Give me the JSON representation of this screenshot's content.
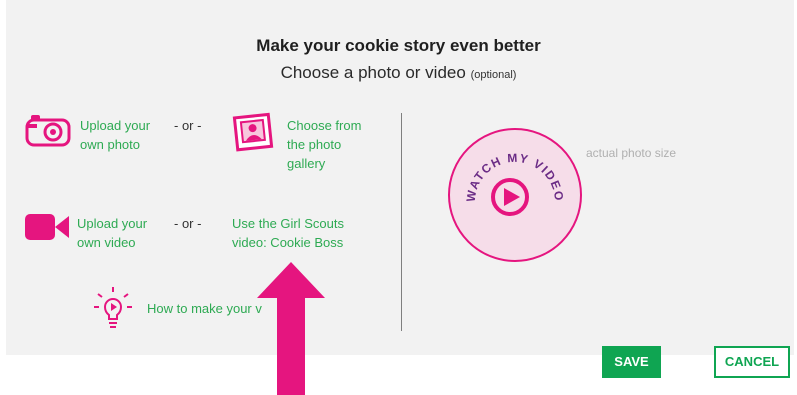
{
  "dialog": {
    "title": "Make your cookie story even better",
    "subtitle": "Choose a photo or video",
    "optional": "(optional)"
  },
  "photo": {
    "upload_line1": "Upload your",
    "upload_line2": "own photo",
    "or": "- or -",
    "gallery_line1": "Choose from",
    "gallery_line2": "the photo",
    "gallery_line3": "gallery"
  },
  "video": {
    "upload_line1": "Upload your",
    "upload_line2": "own video",
    "or": "- or -",
    "gs_line1": "Use the Girl Scouts",
    "gs_line2": "video: Cookie Boss"
  },
  "howto": {
    "label": "How to make your v"
  },
  "preview": {
    "badge_text": "WATCH MY VIDEO",
    "actual_size": "actual photo size"
  },
  "buttons": {
    "save": "SAVE",
    "cancel": "CANCEL"
  },
  "colors": {
    "pink": "#e5157f",
    "green": "#2eaa53",
    "button_green": "#0fa552"
  },
  "icons": [
    "camera-icon",
    "photo-gallery-icon",
    "video-camera-icon",
    "lightbulb-play-icon",
    "play-icon",
    "arrow-up-icon"
  ]
}
